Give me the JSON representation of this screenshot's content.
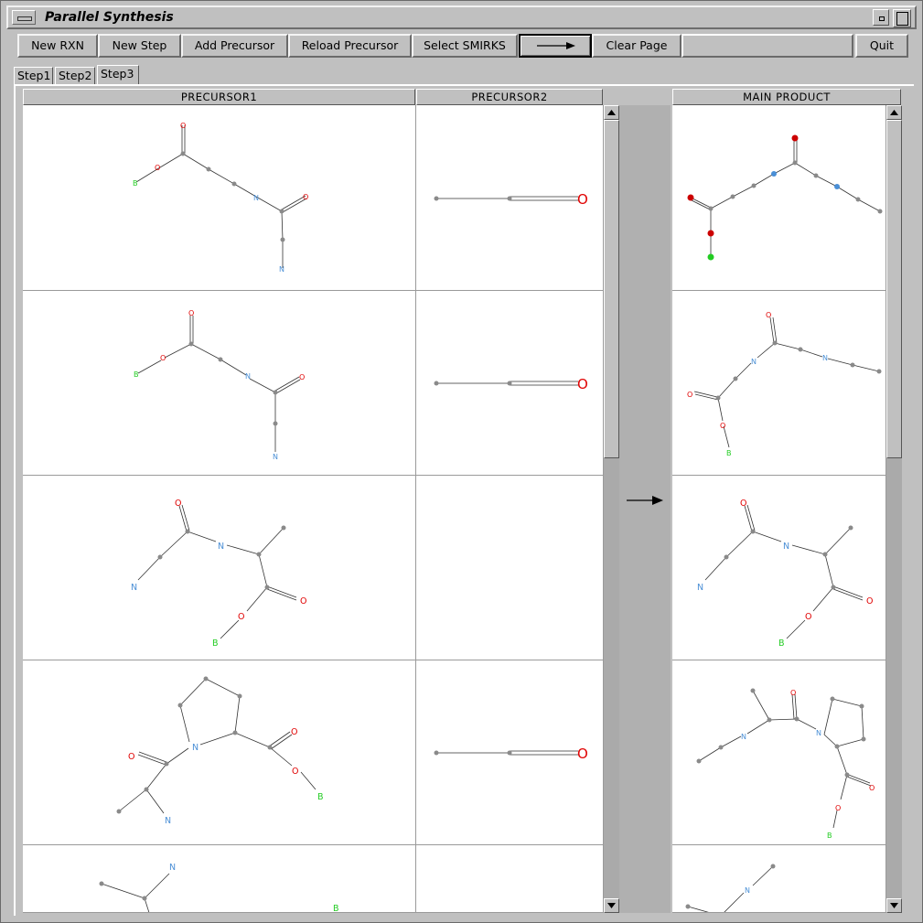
{
  "window": {
    "title": "Parallel Synthesis"
  },
  "toolbar": {
    "new_rxn": "New RXN",
    "new_step": "New Step",
    "add_precursor": "Add Precursor",
    "reload_precursor": "Reload Precursor",
    "select_smirks": "Select SMIRKS",
    "arrow_button": "arrow-right-icon",
    "clear_page": "Clear Page",
    "quit": "Quit"
  },
  "tabs": [
    "Step1",
    "Step2",
    "Step3"
  ],
  "selected_tab": "Step3",
  "columns": {
    "precursor1": "PRECURSOR1",
    "precursor2": "PRECURSOR2",
    "main_product": "MAIN PRODUCT"
  },
  "atoms": {
    "oxygen": "O",
    "nitrogen": "N",
    "boron": "B"
  },
  "colors": {
    "oxygen": "#e00000",
    "nitrogen": "#4a8fd6",
    "boron": "#22cc22",
    "carbon": "#808080"
  }
}
